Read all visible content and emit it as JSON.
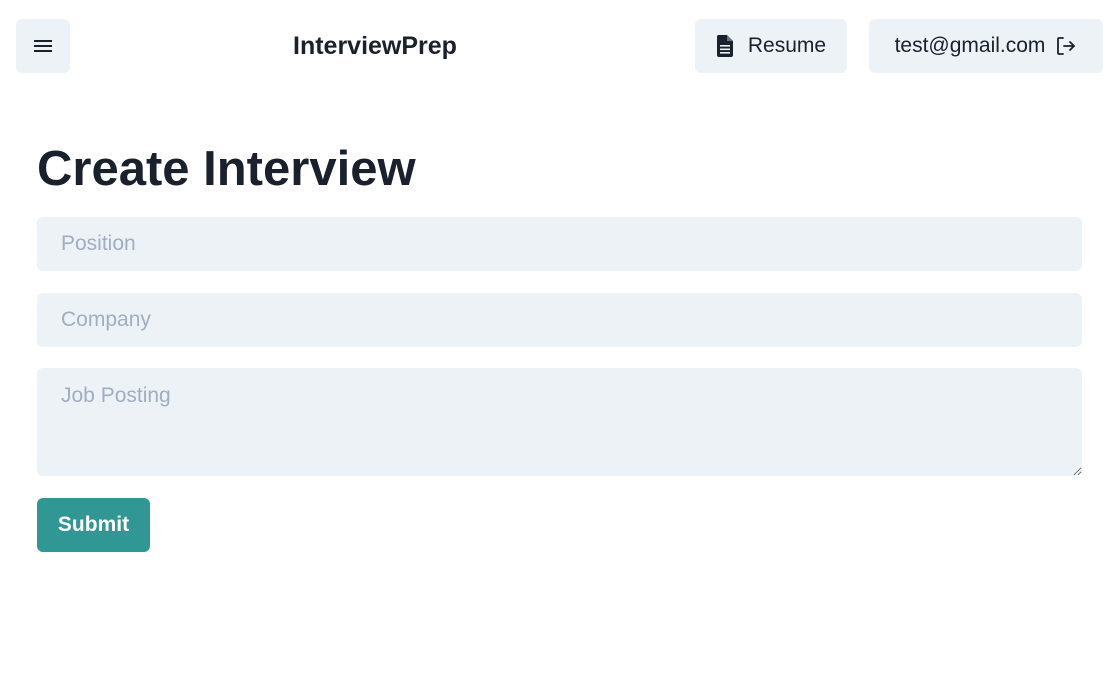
{
  "header": {
    "menu_icon": "hamburger-menu-icon",
    "brand": "InterviewPrep",
    "resume_label": "Resume",
    "resume_icon": "document-icon",
    "user_email": "test@gmail.com",
    "logout_icon": "logout-icon"
  },
  "main": {
    "title": "Create Interview",
    "fields": {
      "position_placeholder": "Position",
      "company_placeholder": "Company",
      "job_posting_placeholder": "Job Posting"
    },
    "submit_label": "Submit"
  },
  "colors": {
    "button_bg": "#edf2f7",
    "field_bg": "#edf2f7",
    "accent": "#319795",
    "text": "#1a202c",
    "placeholder": "#a0aec0"
  }
}
